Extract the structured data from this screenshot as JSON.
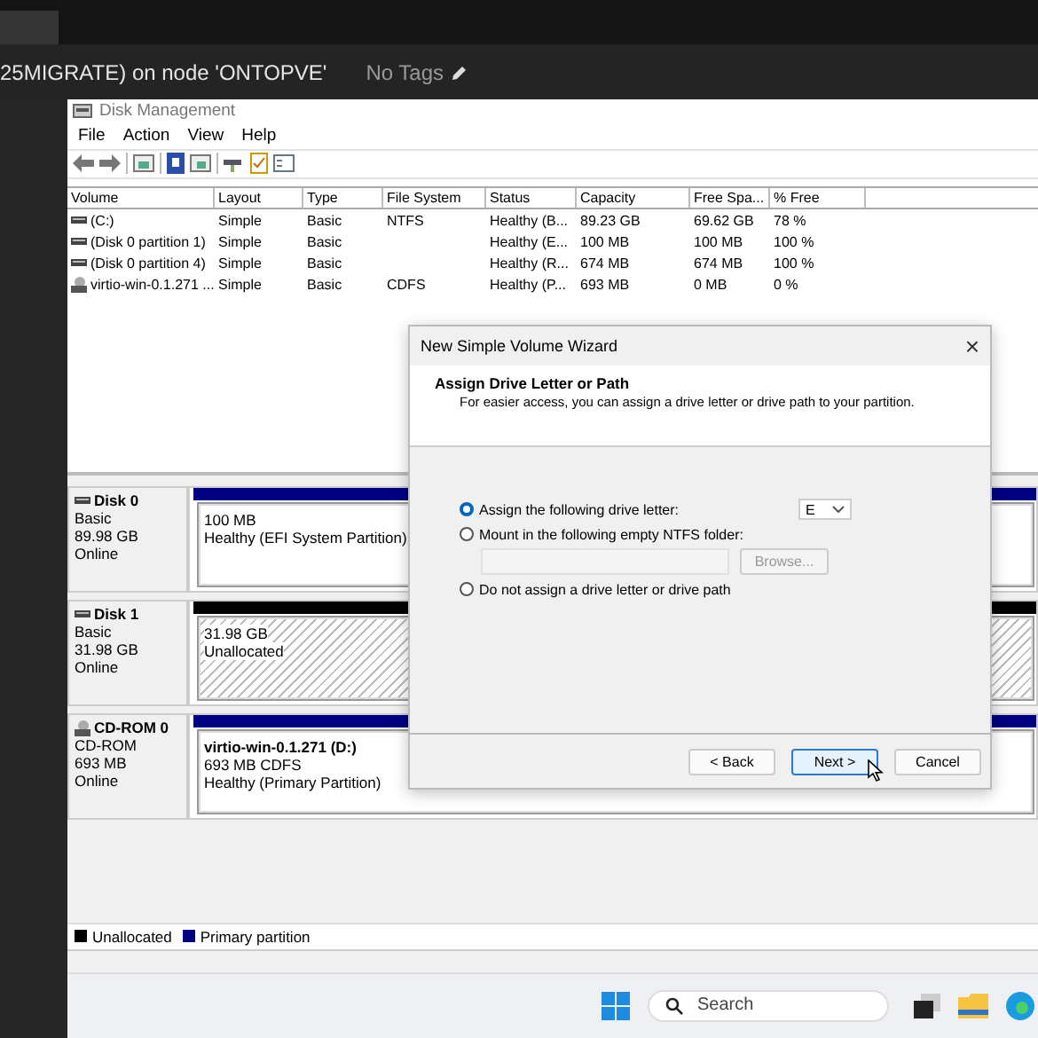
{
  "header": {
    "title": "25MIGRATE) on node 'ONTOPVE'",
    "tags": "No Tags"
  },
  "window": {
    "title": "Disk Management",
    "menu": [
      "File",
      "Action",
      "View",
      "Help"
    ],
    "table": {
      "columns": [
        "Volume",
        "Layout",
        "Type",
        "File System",
        "Status",
        "Capacity",
        "Free Spa...",
        "% Free"
      ],
      "rows": [
        {
          "kind": "disk",
          "cells": [
            "(C:)",
            "Simple",
            "Basic",
            "NTFS",
            "Healthy (B...",
            "89.23 GB",
            "69.62 GB",
            "78 %"
          ]
        },
        {
          "kind": "disk",
          "cells": [
            "(Disk 0 partition 1)",
            "Simple",
            "Basic",
            "",
            "Healthy (E...",
            "100 MB",
            "100 MB",
            "100 %"
          ]
        },
        {
          "kind": "disk",
          "cells": [
            "(Disk 0 partition 4)",
            "Simple",
            "Basic",
            "",
            "Healthy (R...",
            "674 MB",
            "674 MB",
            "100 %"
          ]
        },
        {
          "kind": "cdrom",
          "cells": [
            "virtio-win-0.1.271 ...",
            "Simple",
            "Basic",
            "CDFS",
            "Healthy (P...",
            "693 MB",
            "0 MB",
            "0 %"
          ]
        }
      ]
    },
    "disks": [
      {
        "kind": "disk",
        "name": "Disk 0",
        "lines": [
          "Basic",
          "89.98 GB",
          "Online"
        ],
        "partition": {
          "kind": "primary",
          "color": "#000080",
          "lines": [
            "100 MB",
            "Healthy (EFI System Partition)"
          ]
        }
      },
      {
        "kind": "disk",
        "name": "Disk 1",
        "lines": [
          "Basic",
          "31.98 GB",
          "Online"
        ],
        "partition": {
          "kind": "unallocated",
          "color": "#000000",
          "lines": [
            "31.98 GB",
            "Unallocated"
          ]
        }
      },
      {
        "kind": "cdrom",
        "name": "CD-ROM 0",
        "lines": [
          "CD-ROM",
          "693 MB",
          "Online"
        ],
        "partition": {
          "kind": "primary",
          "color": "#000080",
          "title": "virtio-win-0.1.271  (D:)",
          "lines": [
            "693 MB CDFS",
            "Healthy (Primary Partition)"
          ]
        }
      }
    ],
    "legend": [
      {
        "label": "Unallocated",
        "color": "#000000"
      },
      {
        "label": "Primary partition",
        "color": "#000080"
      }
    ]
  },
  "dialog": {
    "title": "New Simple Volume Wizard",
    "close": "×",
    "heading": "Assign Drive Letter or Path",
    "subtitle": "For easier access, you can assign a drive letter or drive path to your partition.",
    "options": [
      {
        "kind": "letter",
        "label": "Assign the following drive letter:",
        "selected": true
      },
      {
        "kind": "folder",
        "label": "Mount in the following empty NTFS folder:",
        "selected": false
      },
      {
        "kind": "none",
        "label": "Do not assign a drive letter or drive path",
        "selected": false
      }
    ],
    "drive_letter": "E",
    "browse": {
      "label": "Browse...",
      "disabled": true
    },
    "buttons": [
      {
        "label": "< Back",
        "focused": false
      },
      {
        "label": "Next >",
        "focused": true
      },
      {
        "label": "Cancel",
        "focused": false
      }
    ]
  },
  "taskbar": {
    "search_placeholder": "Search"
  }
}
